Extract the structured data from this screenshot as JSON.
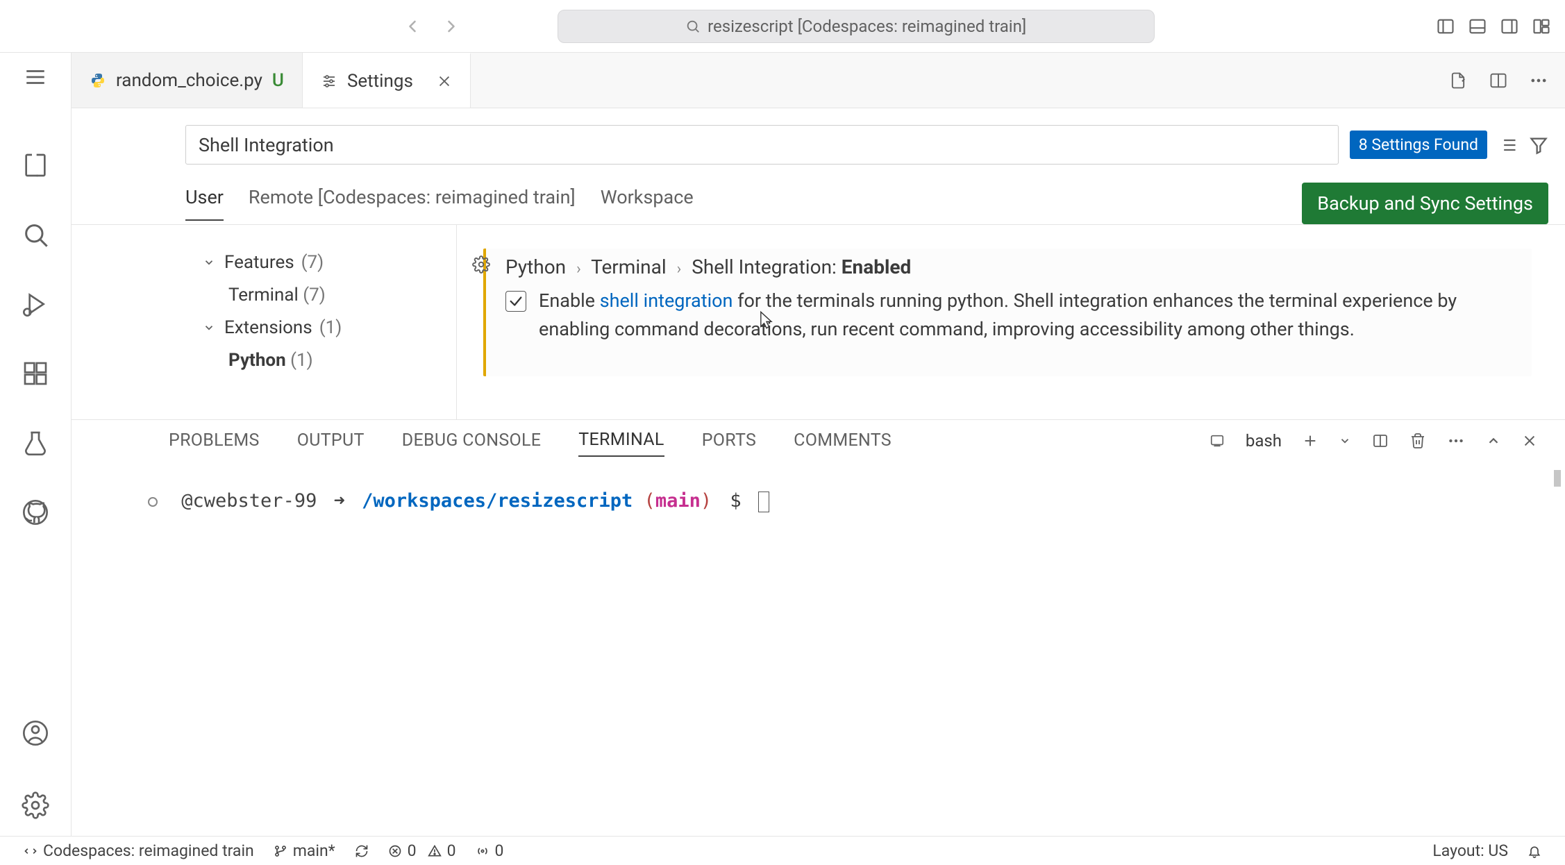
{
  "titlebar": {
    "search_text": "resizescript [Codespaces: reimagined train]"
  },
  "tabs": {
    "file": {
      "name": "random_choice.py",
      "status": "U"
    },
    "settings": {
      "label": "Settings"
    }
  },
  "settings": {
    "search_value": "Shell Integration",
    "found_badge": "8 Settings Found",
    "scopes": {
      "user": "User",
      "remote": "Remote [Codespaces: reimagined train]",
      "workspace": "Workspace"
    },
    "backup_btn": "Backup and Sync Settings",
    "tree": {
      "features": {
        "label": "Features",
        "count": "(7)"
      },
      "terminal": {
        "label": "Terminal",
        "count": "(7)"
      },
      "extensions": {
        "label": "Extensions",
        "count": "(1)"
      },
      "python": {
        "label": "Python",
        "count": "(1)"
      }
    },
    "item": {
      "crumb1": "Python",
      "crumb2": "Terminal",
      "crumb3": "Shell Integration:",
      "crumb4": "Enabled",
      "desc_pre": "Enable ",
      "desc_link": "shell integration",
      "desc_post": " for the terminals running python. Shell integration enhances the terminal experience by enabling command decorations, run recent command, improving accessibility among other things."
    }
  },
  "panel": {
    "tabs": {
      "problems": "PROBLEMS",
      "output": "OUTPUT",
      "debug": "DEBUG CONSOLE",
      "terminal": "TERMINAL",
      "ports": "PORTS",
      "comments": "COMMENTS"
    },
    "terminal_kind": "bash",
    "prompt": {
      "user": "@cwebster-99",
      "arrow": "➜",
      "path": "/workspaces/resizescript",
      "paren_open": "(",
      "branch": "main",
      "paren_close": ")",
      "dollar": "$"
    }
  },
  "statusbar": {
    "codespace": "Codespaces: reimagined train",
    "branch": "main*",
    "errors": "0",
    "warnings": "0",
    "ports": "0",
    "layout": "Layout: US"
  }
}
